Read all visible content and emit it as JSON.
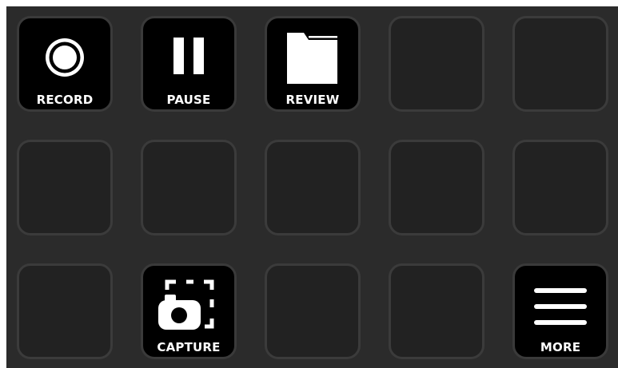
{
  "background_color": "#2b2b2b",
  "keys": [
    {
      "label": "RECORD",
      "icon": "record-icon",
      "active": true
    },
    {
      "label": "PAUSE",
      "icon": "pause-icon",
      "active": true
    },
    {
      "label": "REVIEW",
      "icon": "folder-icon",
      "active": true
    },
    {
      "label": "",
      "icon": "",
      "active": false
    },
    {
      "label": "",
      "icon": "",
      "active": false
    },
    {
      "label": "",
      "icon": "",
      "active": false
    },
    {
      "label": "",
      "icon": "",
      "active": false
    },
    {
      "label": "",
      "icon": "",
      "active": false
    },
    {
      "label": "",
      "icon": "",
      "active": false
    },
    {
      "label": "",
      "icon": "",
      "active": false
    },
    {
      "label": "",
      "icon": "",
      "active": false
    },
    {
      "label": "CAPTURE",
      "icon": "camera-capture-icon",
      "active": true
    },
    {
      "label": "",
      "icon": "",
      "active": false
    },
    {
      "label": "",
      "icon": "",
      "active": false
    },
    {
      "label": "MORE",
      "icon": "menu-icon",
      "active": true
    }
  ]
}
